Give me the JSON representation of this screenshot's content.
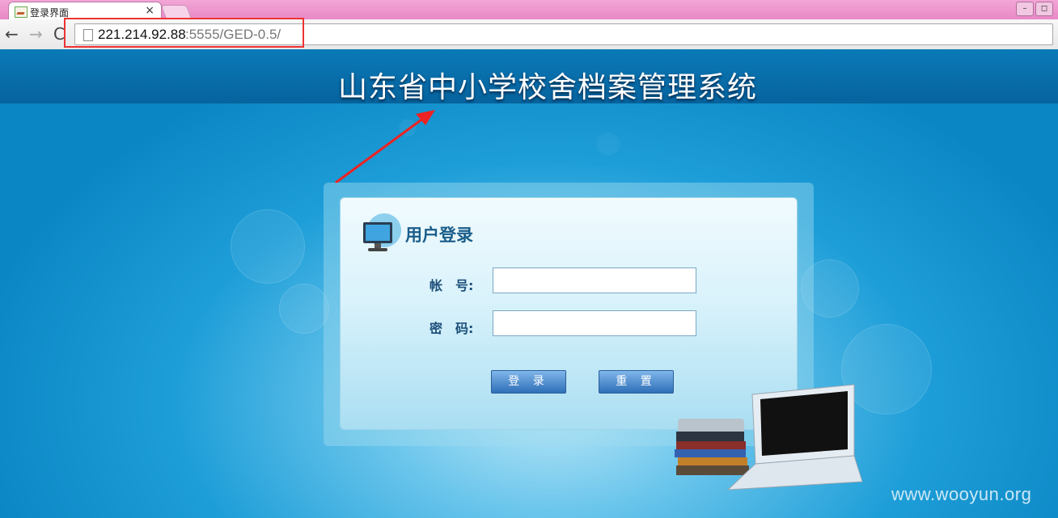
{
  "browser": {
    "tab_title": "登录界面",
    "tab_close": "×",
    "url_host": "221.214.92.88",
    "url_path": ":5555/GED-0.5/",
    "back": "←",
    "forward": "→",
    "reload": "C",
    "window_controls": [
      "–",
      "◻"
    ]
  },
  "page": {
    "system_title": "山东省中小学校舍档案管理系统",
    "login_heading": "用户登录",
    "account_label": "帐　号:",
    "password_label": "密　码:",
    "account_value": "",
    "password_value": "",
    "login_button": "登 录",
    "reset_button": "重 置"
  },
  "watermark": "www.wooyun.org",
  "colors": {
    "banner": "#0a7ab8",
    "page_background": "#0a86c4",
    "highlight": "#ee3333",
    "button": "#2f6fb8"
  },
  "icons": [
    "computer-monitor-icon",
    "page-icon",
    "laptop-and-books-illustration"
  ]
}
